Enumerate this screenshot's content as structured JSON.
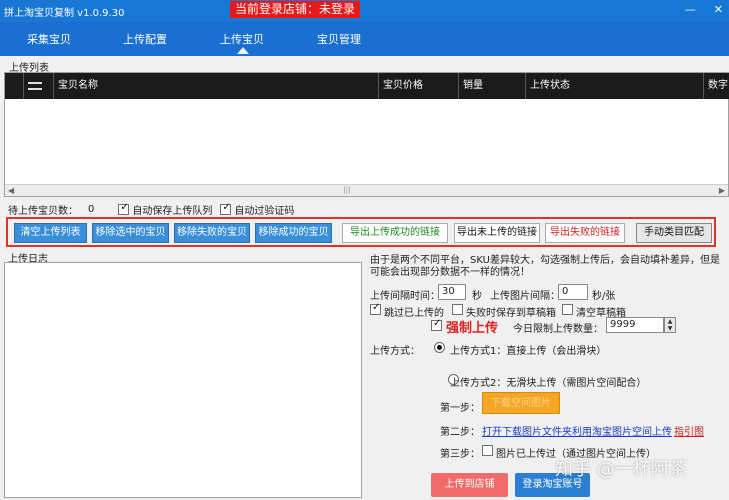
{
  "window": {
    "title": "拼上淘宝贝复制 v1.0.9.30",
    "login_status": "当前登录店铺：未登录",
    "controls": [
      "—",
      "✕"
    ]
  },
  "nav": {
    "tabs": [
      {
        "label": "采集宝贝"
      },
      {
        "label": "上传配置"
      },
      {
        "label": "上传宝贝",
        "active": true
      },
      {
        "label": "宝贝管理"
      }
    ]
  },
  "upload_list": {
    "section_title": "上传列表",
    "columns": [
      "宝贝名称",
      "宝贝价格",
      "销量",
      "上传状态",
      "数字I"
    ],
    "rows": []
  },
  "status_bar": {
    "pending_label": "待上传宝贝数：",
    "pending_count": "0",
    "auto_save_label": "自动保存上传队列",
    "auto_save_checked": true,
    "auto_captcha_label": "自动过验证码",
    "auto_captcha_checked": true
  },
  "action_buttons": [
    {
      "label": "清空上传列表",
      "style": "blue"
    },
    {
      "label": "移除选中的宝贝",
      "style": "blue"
    },
    {
      "label": "移除失败的宝贝",
      "style": "blue"
    },
    {
      "label": "移除成功的宝贝",
      "style": "blue"
    },
    {
      "label": "导出上传成功的链接",
      "style": "white-green"
    },
    {
      "label": "导出未上传的链接",
      "style": "white-black"
    },
    {
      "label": "导出失败的链接",
      "style": "white-red"
    },
    {
      "label": "手动类目匹配",
      "style": "grey"
    }
  ],
  "log": {
    "section_title": "上传日志"
  },
  "settings": {
    "notice": "由于是两个不同平台，SKU差异较大，勾选强制上传后，会自动填补差异，但是可能会出现部分数据不一样的情况！",
    "interval_label": "上传间隔时间：",
    "interval_value": "30",
    "interval_unit": "秒",
    "image_interval_label": "上传图片间隔：",
    "image_interval_value": "0",
    "image_interval_unit": "秒/张",
    "skip_uploaded_label": "跳过已上传的",
    "skip_uploaded_checked": true,
    "save_draft_on_fail_label": "失败时保存到草稿箱",
    "save_draft_on_fail_checked": false,
    "clear_draft_label": "清空草稿箱",
    "clear_draft_checked": false,
    "force_upload_label": "强制上传",
    "force_upload_checked": true,
    "daily_limit_label": "今日限制上传数量：",
    "daily_limit_value": "9999",
    "method_label": "上传方式：",
    "method1_label": "上传方式1：直接上传（会出滑块）",
    "method1_selected": true,
    "method2_label": "上传方式2：无滑块上传（需图片空间配合）",
    "method2_selected": false,
    "step1_label": "第一步：",
    "step1_button": "下载空间图片",
    "step2_label": "第二步：",
    "step2_link": "打开下载图片文件夹利用淘宝图片空间上传",
    "step2_guide": "指引图",
    "step3_label": "第三步：",
    "step3_checkbox_label": "图片已上传过（通过图片空间上传）",
    "step3_checked": false,
    "upload_button": "上传到店铺",
    "login_button": "登录淘宝账号",
    "upload_button_color": "#f26b6b",
    "login_button_color": "#2b7fd0"
  },
  "watermark": "知乎 @一杯阿茶",
  "colors": {
    "title_bar": "#1877d4",
    "nav_bar": "#1a6fd0",
    "login_badge": "#e61a1a",
    "action_frame": "#e0312d",
    "blue_button": "#3a8fd9",
    "force_upload": "#e02020"
  }
}
